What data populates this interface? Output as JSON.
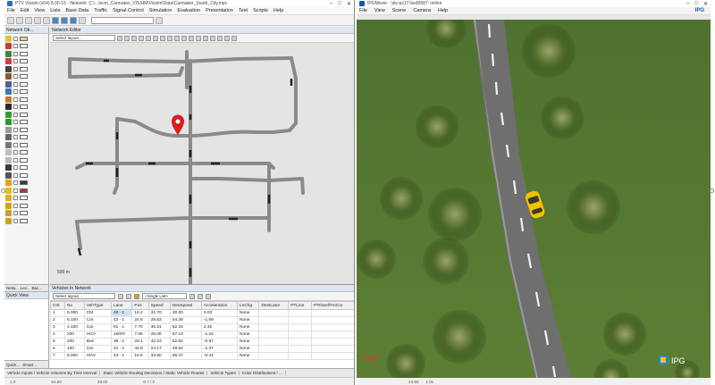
{
  "vissim": {
    "title": "PTV Vissim (x64) 8.00-15 - Network: C:\\...\\ecm_Carmaker_VISSIM\\Vissim\\Data\\Carmaker_South_City.inpx",
    "menu": [
      "File",
      "Edit",
      "View",
      "Lists",
      "Base Data",
      "Traffic",
      "Signal Control",
      "Simulation",
      "Evaluation",
      "Presentation",
      "Test",
      "Scripts",
      "Help"
    ],
    "network_objects_title": "Network Ob...",
    "network_editor_title": "Network Editor",
    "layout_placeholder": "Select layout...",
    "network_obj_tabs": [
      "Netw...",
      "Lev...",
      "Bac..."
    ],
    "quick_view_title": "Quick View",
    "quick_tabs": [
      "Quick...",
      "Smart..."
    ],
    "scale_label": "500 m",
    "vehicles_title": "Vehicles In Network",
    "vehicles_layout": "Select layout...",
    "single_list": "<Single List>",
    "columns": [
      "Cnt",
      "No",
      "VehType",
      "Lane",
      "Pos",
      "Speed",
      "DesSpeed",
      "Acceleration",
      "LnChg",
      "DestLane",
      "PTLine",
      "PTDwellTmCur"
    ],
    "rows": [
      [
        "1",
        "5.000",
        "CM",
        "40 - 1",
        "10.2",
        "31.70",
        "30.00",
        "0.03",
        "None",
        "",
        "",
        ""
      ],
      [
        "2",
        "6.100",
        "Car",
        "42 - 1",
        "24.8",
        "28.63",
        "54.39",
        "-1.69",
        "None",
        "",
        "",
        ""
      ],
      [
        "3",
        "4.100",
        "Car",
        "81 - 1",
        "7.70",
        "36.21",
        "52.15",
        "2.32",
        "None",
        "",
        "",
        ""
      ],
      [
        "4",
        "200",
        "HGV",
        "10007",
        "7.06",
        "26.06",
        "57.13",
        "-1.22",
        "None",
        "",
        "",
        ""
      ],
      [
        "5",
        "200",
        "Bus",
        "38 - 1",
        "29.1",
        "42.23",
        "52.82",
        "-0.87",
        "None",
        "",
        "",
        ""
      ],
      [
        "6",
        "100",
        "Car",
        "41 - 1",
        "42.8",
        "24.17",
        "49.52",
        "-1.47",
        "None",
        "",
        "",
        ""
      ],
      [
        "7",
        "5.000",
        "HGV",
        "43 - 1",
        "16.5",
        "33.60",
        "55.47",
        "-0.44",
        "None",
        "",
        "",
        ""
      ]
    ],
    "bottom_tabs": [
      "Vehicle Inputs / Vehicle Volumes By Time Interval",
      "Static Vehicle Routing Decisions / Static Vehicle Routes",
      "Vehicle Types",
      "Color Distributions / ..."
    ],
    "status_values": [
      "1.0",
      "54.50",
      "48.00",
      "0:7 / 0"
    ]
  },
  "ipg": {
    "title": "IPGMovie - 'ptv-pc17-bed9587' online",
    "menu": [
      "File",
      "View",
      "Scene",
      "Camera",
      "Help"
    ],
    "logo_text": "IPG",
    "corner_logo_text": "IPG",
    "red_label": "NaN",
    "status_values": [
      "",
      "24.50",
      "1.0x"
    ]
  },
  "colors": {
    "grass": "#5a7a32",
    "road": "#6f6f6f",
    "marker": "#d81e1e",
    "car": "#f2c200",
    "link": "#8a8a8a"
  }
}
